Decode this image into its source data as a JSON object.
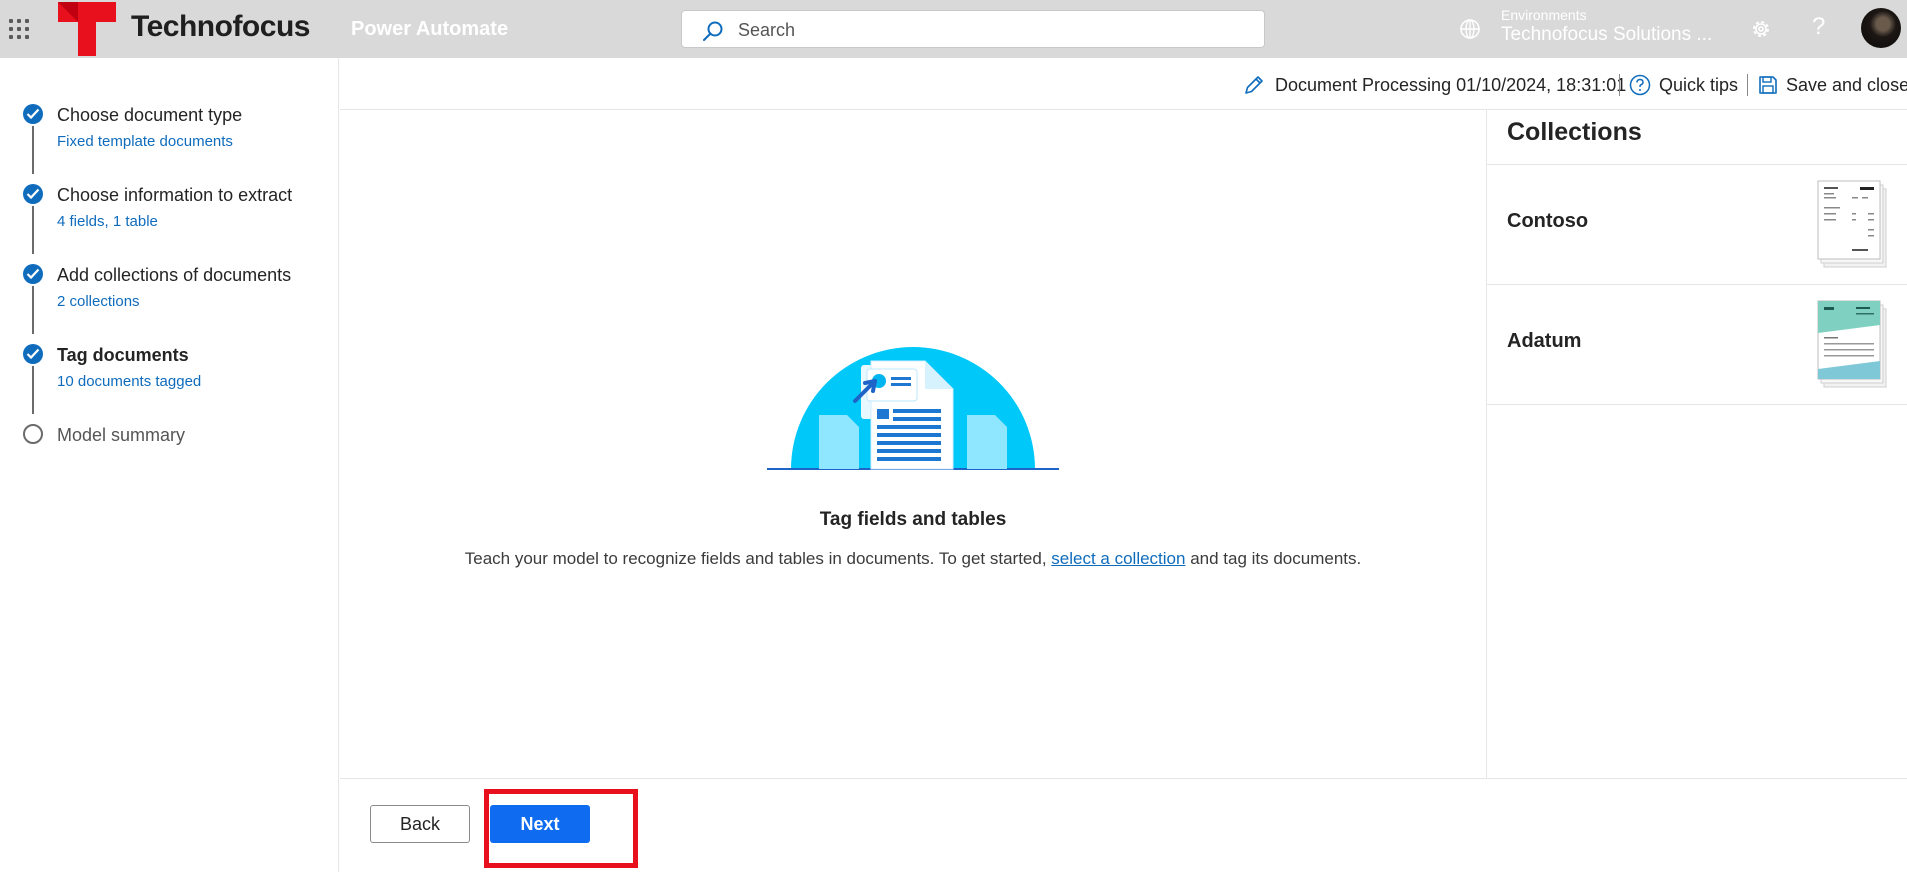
{
  "topbar": {
    "brand_name": "Technofocus",
    "app_name": "Power Automate",
    "search_placeholder": "Search",
    "environment_label": "Environments",
    "environment_name": "Technofocus Solutions ...",
    "help_symbol": "?",
    "icons": [
      "waffle-icon",
      "search-icon",
      "environment-icon",
      "gear-icon",
      "help-icon"
    ]
  },
  "steps": [
    {
      "title": "Choose document type",
      "subtitle": "Fixed template documents",
      "state": "done"
    },
    {
      "title": "Choose information to extract",
      "subtitle": "4 fields, 1 table",
      "state": "done"
    },
    {
      "title": "Add collections of documents",
      "subtitle": "2 collections",
      "state": "done"
    },
    {
      "title": "Tag documents",
      "subtitle": "10 documents tagged",
      "state": "current"
    },
    {
      "title": "Model summary",
      "subtitle": "",
      "state": "pending"
    }
  ],
  "header": {
    "document_title": "Document Processing 01/10/2024, 18:31:01",
    "quick_tips": "Quick tips",
    "save_and_close": "Save and close"
  },
  "main": {
    "title": "Tag fields and tables",
    "desc_before": "Teach your model to recognize fields and tables in documents. To get started, ",
    "link_text": "select a collection",
    "desc_after": " and tag its documents."
  },
  "collections": {
    "heading": "Collections",
    "items": [
      {
        "name": "Contoso"
      },
      {
        "name": "Adatum"
      }
    ]
  },
  "footer": {
    "back_label": "Back",
    "next_label": "Next"
  },
  "colors": {
    "accent": "#0f6cbd",
    "primary_button": "#0f6cf0",
    "highlight": "#e8101d",
    "brand_red": "#e8101d",
    "topbar": "#d9d9d9",
    "illustration_circle": "#00c8f8"
  }
}
